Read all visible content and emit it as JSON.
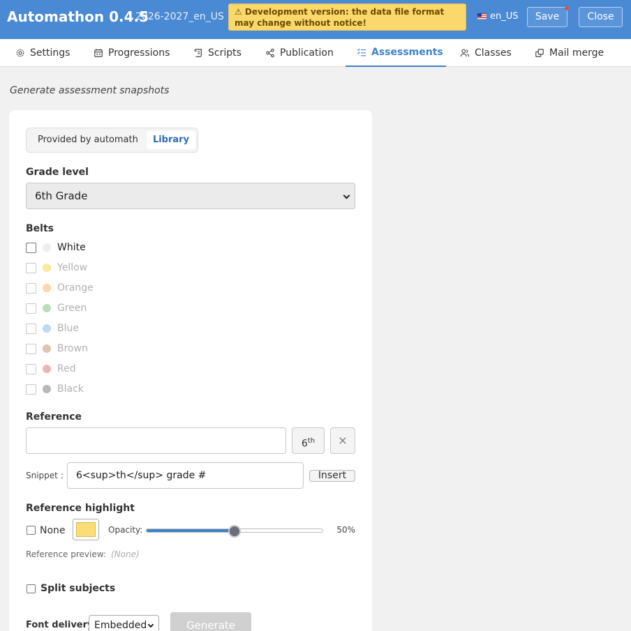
{
  "header": {
    "title": "Automathon 0.4.5",
    "db_name": "2026-2027_en_US",
    "warning": "⚠ Development version: the data file format may change without notice!",
    "language": "en_US",
    "save_label": "Save",
    "close_label": "Close"
  },
  "tabs": [
    {
      "label": "Settings",
      "icon": "gear-icon"
    },
    {
      "label": "Progressions",
      "icon": "calendar-icon"
    },
    {
      "label": "Scripts",
      "icon": "scroll-icon"
    },
    {
      "label": "Publication",
      "icon": "share-icon"
    },
    {
      "label": "Assessments",
      "icon": "checklist-icon",
      "active": true
    },
    {
      "label": "Classes",
      "icon": "users-icon"
    },
    {
      "label": "Mail merge",
      "icon": "copy-icon"
    }
  ],
  "page": {
    "subtitle": "Generate assessment snapshots"
  },
  "source": {
    "options": [
      "Provided by automath",
      "Library"
    ],
    "selected": "Library"
  },
  "grade": {
    "label": "Grade level",
    "value": "6th Grade"
  },
  "belts": {
    "label": "Belts",
    "items": [
      {
        "label": "White",
        "color": "#eeeeee",
        "enabled": true
      },
      {
        "label": "Yellow",
        "color": "#fbe89a",
        "enabled": false
      },
      {
        "label": "Orange",
        "color": "#f9d9a4",
        "enabled": false
      },
      {
        "label": "Green",
        "color": "#b9dfbd",
        "enabled": false
      },
      {
        "label": "Blue",
        "color": "#bcd9f5",
        "enabled": false
      },
      {
        "label": "Brown",
        "color": "#e0c3b0",
        "enabled": false
      },
      {
        "label": "Red",
        "color": "#efb3ba",
        "enabled": false
      },
      {
        "label": "Black",
        "color": "#b8b8b8",
        "enabled": false
      }
    ]
  },
  "reference": {
    "label": "Reference",
    "value": "",
    "sup_button_base": "6",
    "sup_button_sup": "th",
    "clear_label": "×",
    "snippet_label": "Snippet :",
    "snippet_value": "6<sup>th</sup> grade #",
    "insert_label": "Insert"
  },
  "highlight": {
    "label": "Reference highlight",
    "none_label": "None",
    "color": "#fcdc76",
    "opacity_label": "Opacity:",
    "opacity_value": 0.5,
    "opacity_text": "50%",
    "preview_label": "Reference preview:",
    "preview_value": "(None)"
  },
  "split": {
    "label": "Split subjects"
  },
  "font": {
    "label": "Font delivery",
    "value": "Embedded"
  },
  "generate_label": "Generate"
}
